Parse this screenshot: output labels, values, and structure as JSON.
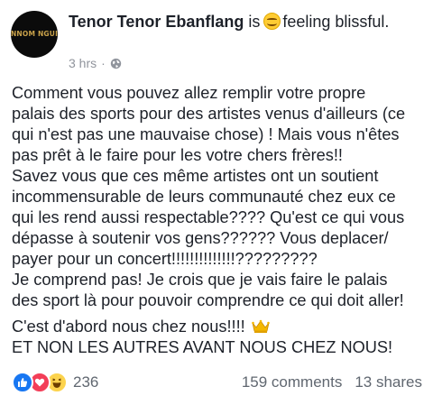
{
  "post": {
    "author": "Tenor Tenor Ebanflang",
    "verb": "is",
    "feeling_text": "feeling blissful.",
    "feeling_icon": "smiling-face-icon",
    "avatar_text_line1": "NNOM NGUI",
    "avatar_text_line2": "",
    "time": "3 hrs",
    "separator": "·",
    "privacy_icon": "globe-icon",
    "body_lines": [
      "Comment vous pouvez allez remplir votre propre",
      "palais des sports pour des artistes venus d'ailleurs (ce",
      "qui n'est pas une mauvaise chose) ! Mais vous n'êtes",
      "pas prêt à le faire pour les votre chers frères!!",
      "Savez vous que ces même artistes ont un soutient",
      "incommensurable de leurs communauté chez eux ce",
      "qui les rend aussi respectable???? Qu'est ce qui vous",
      "dépasse à soutenir vos gens?????? Vous deplacer/",
      "payer pour un concert!!!!!!!!!!!!!!?????????",
      "Je comprend pas! Je crois que je vais faire le palais",
      "des sport là pour pouvoir comprendre ce qui doit aller!"
    ],
    "closing_line1": "C'est d'abord nous chez nous!!!!",
    "closing_icon": "crown-icon",
    "closing_line2": "ET NON LES AUTRES AVANT NOUS CHEZ NOUS!"
  },
  "footer": {
    "reaction_icons": [
      "like-icon",
      "love-icon",
      "haha-icon"
    ],
    "reaction_count": "236",
    "comments": "159 comments",
    "shares": "13 shares"
  },
  "colors": {
    "like": "#1877f2",
    "love": "#f33e58",
    "haha": "#fcd34d",
    "meta_text": "#90949c"
  }
}
